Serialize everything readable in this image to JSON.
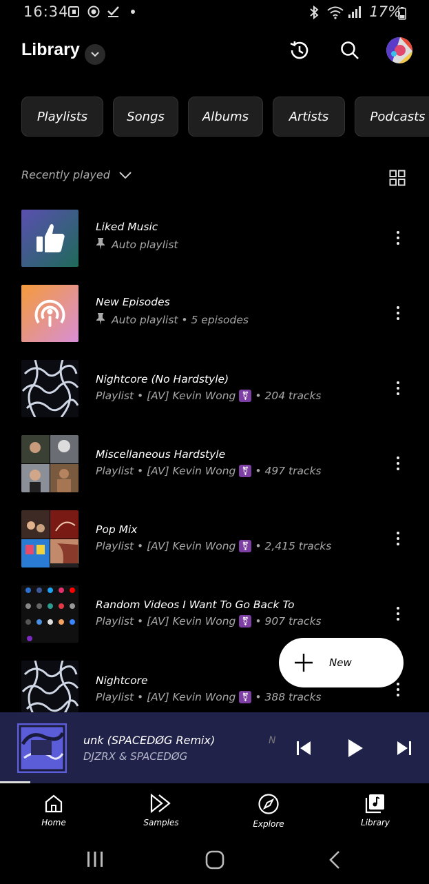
{
  "status_bar": {
    "time": "16:34",
    "battery": "17%"
  },
  "header": {
    "title": "Library"
  },
  "chips": [
    "Playlists",
    "Songs",
    "Albums",
    "Artists",
    "Podcasts"
  ],
  "sort": {
    "label": "Recently played"
  },
  "items": [
    {
      "title": "Liked Music",
      "subtitle": "Auto playlist",
      "pinned": true
    },
    {
      "title": "New Episodes",
      "subtitle": "Auto playlist • 5 episodes",
      "pinned": true
    },
    {
      "title": "Nightcore (No Hardstyle)",
      "sub_prefix": "Playlist • [AV] Kevin Wong",
      "sub_suffix": "• 204 tracks"
    },
    {
      "title": "Miscellaneous Hardstyle",
      "sub_prefix": "Playlist • [AV] Kevin Wong",
      "sub_suffix": "• 497 tracks"
    },
    {
      "title": "Pop Mix",
      "sub_prefix": "Playlist • [AV] Kevin Wong",
      "sub_suffix": "• 2,415 tracks"
    },
    {
      "title": "Random Videos I Want To Go Back To",
      "sub_prefix": "Playlist • [AV] Kevin Wong",
      "sub_suffix": "• 907 tracks"
    },
    {
      "title": "Nightcore",
      "sub_prefix": "Playlist • [AV] Kevin Wong",
      "sub_suffix": "• 388 tracks"
    }
  ],
  "fab": {
    "label": "New"
  },
  "now_playing": {
    "title": "unk (SPACEDØG Remix)",
    "artist": "DJZRX & SPACEDØG",
    "ghost": "N",
    "progress_fraction": 0.07
  },
  "nav": [
    {
      "label": "Home",
      "icon": "home-icon"
    },
    {
      "label": "Samples",
      "icon": "samples-icon"
    },
    {
      "label": "Explore",
      "icon": "explore-icon"
    },
    {
      "label": "Library",
      "icon": "library-icon"
    }
  ],
  "colors": {
    "background": "#000000",
    "chip_bg": "#1f1f1f",
    "miniplayer_bg": "#20224a",
    "subtitle": "#a8a8a8"
  }
}
